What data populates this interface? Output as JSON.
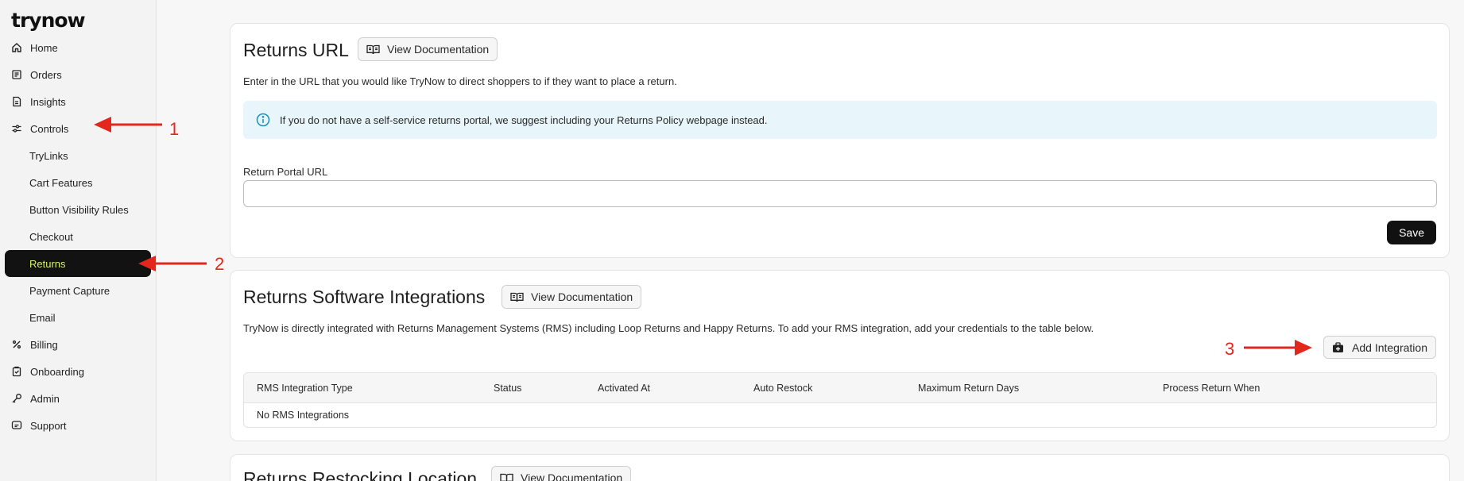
{
  "sidebar": {
    "logo": "trynow",
    "items": [
      {
        "label": "Home"
      },
      {
        "label": "Orders"
      },
      {
        "label": "Insights"
      },
      {
        "label": "Controls"
      },
      {
        "label": "TryLinks"
      },
      {
        "label": "Cart Features"
      },
      {
        "label": "Button Visibility Rules"
      },
      {
        "label": "Checkout"
      },
      {
        "label": "Returns"
      },
      {
        "label": "Payment Capture"
      },
      {
        "label": "Email"
      },
      {
        "label": "Billing"
      },
      {
        "label": "Onboarding"
      },
      {
        "label": "Admin"
      },
      {
        "label": "Support"
      }
    ],
    "active": "Returns"
  },
  "returns_url": {
    "title": "Returns URL",
    "doc_button": "View Documentation",
    "description": "Enter in the URL that you would like TryNow to direct shoppers to if they want to place a return.",
    "info": "If you do not have a self-service returns portal, we suggest including your Returns Policy webpage instead.",
    "field_label": "Return Portal URL",
    "field_value": "",
    "save_label": "Save"
  },
  "integrations": {
    "title": "Returns Software Integrations",
    "doc_button": "View Documentation",
    "description": "TryNow is directly integrated with Returns Management Systems (RMS) including Loop Returns and Happy Returns. To add your RMS integration, add your credentials to the table below.",
    "add_button": "Add Integration",
    "columns": [
      "RMS Integration Type",
      "Status",
      "Activated At",
      "Auto Restock",
      "Maximum Return Days",
      "Process Return When"
    ],
    "empty_text": "No RMS Integrations"
  },
  "restocking": {
    "title": "Returns Restocking Location",
    "doc_button": "View Documentation"
  },
  "annotations": {
    "one": "1",
    "two": "2",
    "three": "3",
    "color": "#e3271c"
  },
  "colors": {
    "active_bg": "#121212",
    "active_text": "#d6f26b",
    "info_bg": "#e8f5fa",
    "info_icon": "#1a8fc2"
  }
}
